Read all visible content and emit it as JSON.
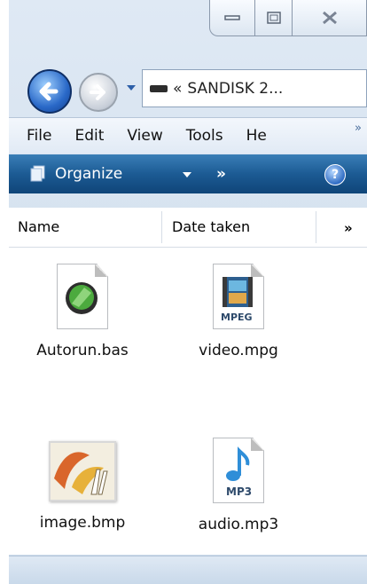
{
  "window": {
    "buttons": [
      "minimize",
      "maximize",
      "close"
    ]
  },
  "address_bar": {
    "path_prefix": "«",
    "path_text": "SANDISK 2..."
  },
  "menu": {
    "items": [
      "File",
      "Edit",
      "View",
      "Tools",
      "He"
    ],
    "overflow": "»"
  },
  "command_bar": {
    "organize_label": "Organize",
    "overflow": "»",
    "help_label": "?"
  },
  "columns": {
    "name": "Name",
    "date_taken": "Date taken",
    "overflow": "»"
  },
  "files": [
    {
      "name": "Autorun.bas",
      "icon": "bas-script-icon"
    },
    {
      "name": "video.mpg",
      "icon": "mpeg-video-icon",
      "badge": "MPEG"
    },
    {
      "name": "image.bmp",
      "icon": "bmp-image-icon"
    },
    {
      "name": "audio.mp3",
      "icon": "mp3-audio-icon",
      "badge": "MP3"
    }
  ],
  "colors": {
    "command_bar": "#1c5b94",
    "frame": "#dfe9f4",
    "nav_back": "#2a69c8"
  }
}
